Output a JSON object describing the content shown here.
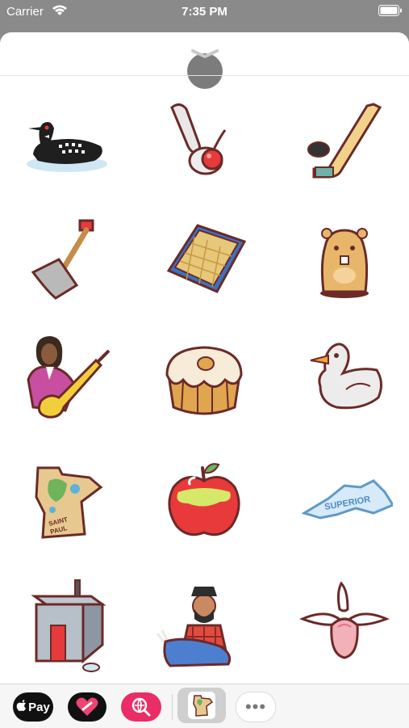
{
  "status_bar": {
    "carrier": "Carrier",
    "time": "7:35 PM",
    "icons": [
      "wifi-icon",
      "battery-icon"
    ]
  },
  "sheet": {
    "grabber_icon": "chevron-down-icon"
  },
  "stickers": [
    {
      "name": "loon-sticker"
    },
    {
      "name": "spoon-cherry-sticker"
    },
    {
      "name": "hockey-stick-sticker"
    },
    {
      "name": "snow-shovel-sticker"
    },
    {
      "name": "tater-tot-hotdish-sticker"
    },
    {
      "name": "gopher-sticker"
    },
    {
      "name": "guitarist-sticker"
    },
    {
      "name": "caramel-roll-sticker"
    },
    {
      "name": "duck-sticker"
    },
    {
      "name": "minnesota-map-sticker",
      "text_line1": "SAINT",
      "text_line2": "PAUL"
    },
    {
      "name": "apple-sticker"
    },
    {
      "name": "lake-superior-sticker",
      "text": "SUPERIOR"
    },
    {
      "name": "ice-house-sticker"
    },
    {
      "name": "lumberjack-ox-sticker"
    },
    {
      "name": "ladys-slipper-sticker"
    }
  ],
  "drawer": {
    "apple_pay_label": "Pay",
    "more_label": "•••",
    "apps": [
      "apple-pay-icon",
      "heart-app-icon",
      "search-web-icon",
      "minnesota-stickers-icon",
      "more-apps-icon"
    ]
  },
  "colors": {
    "outline": "#6b2a28",
    "accent_red": "#e63b3b",
    "brand_pink": "#ea2c67"
  }
}
